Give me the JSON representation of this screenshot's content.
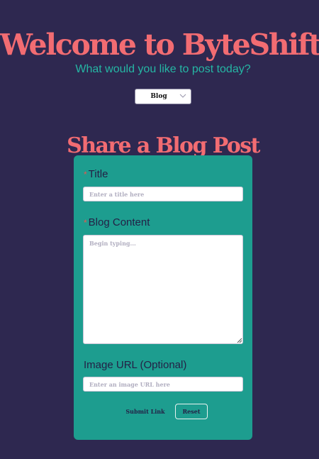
{
  "header": {
    "title": "Welcome to ByteShift!",
    "subtitle": "What would you like to post today?"
  },
  "post_type_select": {
    "value": "Blog",
    "icon": "chevron-down-icon"
  },
  "form": {
    "heading": "Share a Blog Post",
    "required_marker": "*",
    "title_label": "Title",
    "title_placeholder": "Enter a title here",
    "title_value": "",
    "content_label": "Blog Content",
    "content_placeholder": "Begin typing...",
    "content_value": "",
    "image_label": "Image URL (Optional)",
    "image_placeholder": "Enter an image URL here",
    "image_value": "",
    "submit_label": "Submit Link",
    "reset_label": "Reset"
  },
  "colors": {
    "background": "#2e2850",
    "accent_coral": "#f26c72",
    "accent_teal": "#25b6a4",
    "card_teal": "#1d9d8f",
    "label_dark": "#241f45",
    "required_red": "#e8564f"
  }
}
